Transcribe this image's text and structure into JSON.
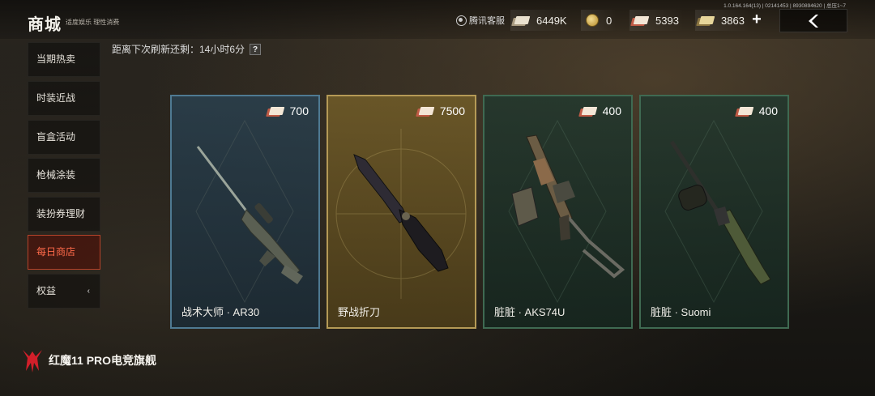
{
  "header": {
    "title": "商城",
    "subtitle": "适度娱乐 理性消费",
    "version": "1.0.164.164(13) | 02141453 | 8930894620 | 总压1~7",
    "customer_service": "腾讯客服"
  },
  "currencies": [
    {
      "icon": "ticket-icon",
      "value": "6449K"
    },
    {
      "icon": "coin-icon",
      "value": "0"
    },
    {
      "icon": "red-ticket-icon",
      "value": "5393"
    },
    {
      "icon": "gold-ticket-icon",
      "value": "3863"
    }
  ],
  "refresh": {
    "label": "距离下次刷新还剩：14小时6分",
    "help": "?"
  },
  "sidebar": {
    "items": [
      {
        "label": "当期热卖"
      },
      {
        "label": "时装近战"
      },
      {
        "label": "盲盒活动"
      },
      {
        "label": "枪械涂装"
      },
      {
        "label": "装扮券理财"
      },
      {
        "label": "每日商店"
      },
      {
        "label": "权益"
      }
    ],
    "active_index": 5,
    "expand_glyph": "‹"
  },
  "items": [
    {
      "name": "战术大师 · AR30",
      "price": "700",
      "rarity_color": "#4f7a92"
    },
    {
      "name": "野战折刀",
      "price": "7500",
      "rarity_color": "#b59a56"
    },
    {
      "name": "脏脏 · AKS74U",
      "price": "400",
      "rarity_color": "#3f6a52"
    },
    {
      "name": "脏脏 · Suomi",
      "price": "400",
      "rarity_color": "#3f6a52"
    }
  ],
  "watermark": "红魔11 PRO电竞旗舰"
}
